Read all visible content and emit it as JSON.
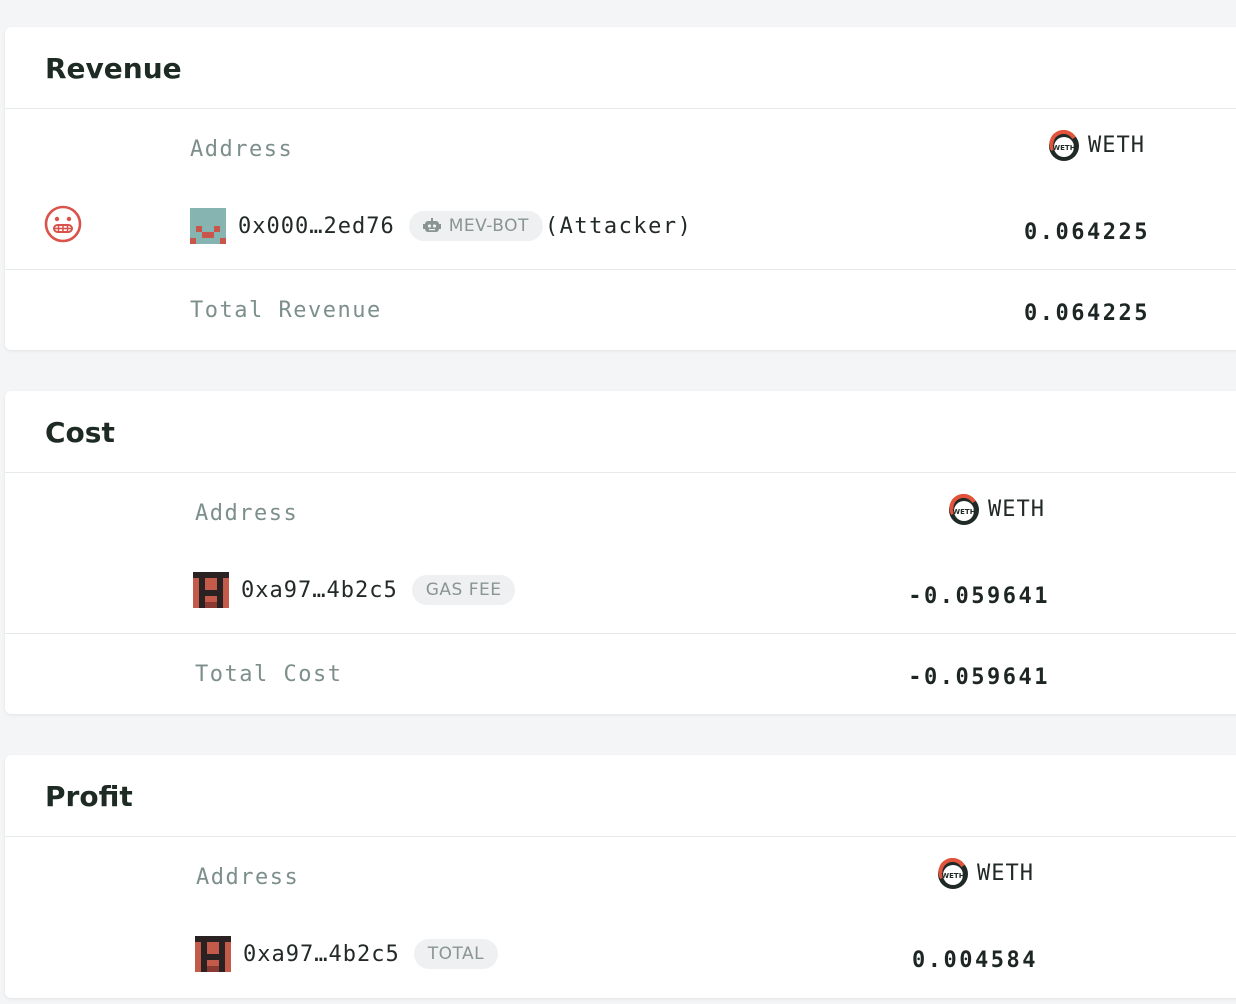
{
  "token": {
    "name": "WETH",
    "logo_text": "WETH",
    "colors": {
      "ring": "#1f2a26",
      "accent": "#e2533b"
    }
  },
  "revenue": {
    "title": "Revenue",
    "address_header": "Address",
    "row": {
      "icon": "grimacing-face-icon",
      "address": "0x000…2ed76",
      "badge": "MEV-BOT",
      "badge_icon": "robot-icon",
      "suffix": "(Attacker)",
      "amount": "0.064225"
    },
    "total_label": "Total Revenue",
    "total_amount": "0.064225"
  },
  "cost": {
    "title": "Cost",
    "address_header": "Address",
    "row": {
      "address": "0xa97…4b2c5",
      "badge": "GAS FEE",
      "amount": "-0.059641"
    },
    "total_label": "Total Cost",
    "total_amount": "-0.059641"
  },
  "profit": {
    "title": "Profit",
    "address_header": "Address",
    "row": {
      "address": "0xa97…4b2c5",
      "badge": "TOTAL",
      "amount": "0.004584"
    }
  }
}
